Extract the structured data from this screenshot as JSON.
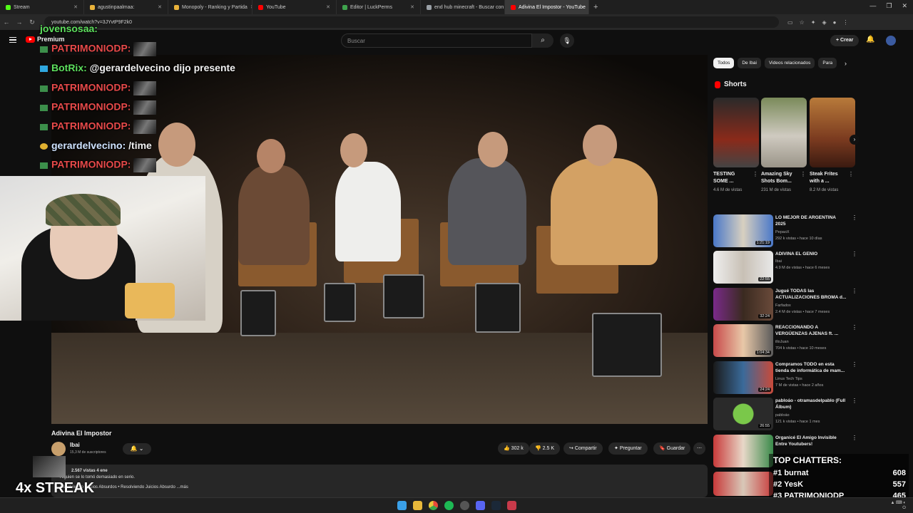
{
  "browser": {
    "tabs": [
      {
        "label": "Stream",
        "color": "#53fc18"
      },
      {
        "label": "agustinpaalmaa:",
        "color": "#e9b23a"
      },
      {
        "label": "Monopoly - Ranking y Partida",
        "color": "#e9b23a"
      },
      {
        "label": "YouTube",
        "color": "#ff0000"
      },
      {
        "label": "Editor | LuckPerms",
        "color": "#3fa34d"
      },
      {
        "label": "end hub minecraft - Buscar con",
        "color": "#9aa0a6"
      },
      {
        "label": "Adivina El Impostor - YouTube",
        "color": "#ff0000"
      }
    ],
    "new_tab": "+",
    "url": "youtube.com/watch?v=3JYvtP9F2k0"
  },
  "header": {
    "premium_label": "Premium",
    "search_placeholder": "Buscar",
    "create_label": "Crear"
  },
  "chat_overlay": [
    {
      "user": "jovensosaa:",
      "text": "",
      "style": "u2"
    },
    {
      "user": "PATRIMONIODP:",
      "text": "",
      "style": "u1"
    },
    {
      "user": "BotRix:",
      "text": "@gerardelvecino dijo presente",
      "style": "u2"
    },
    {
      "user": "PATRIMONIODP:",
      "text": "",
      "style": "u1"
    },
    {
      "user": "PATRIMONIODP:",
      "text": "",
      "style": "u1"
    },
    {
      "user": "PATRIMONIODP:",
      "text": "",
      "style": "u1"
    },
    {
      "user": "gerardelvecino:",
      "text": "/time",
      "style": "u3"
    },
    {
      "user": "PATRIMONIODP:",
      "text": "",
      "style": "u1"
    }
  ],
  "video": {
    "title": "Adivina El Impostor",
    "channel": "Ibai",
    "subscribers": "15,3 M de suscriptores",
    "likes": "302 k",
    "dislikes": "2.5 K",
    "share": "Compartir",
    "ask": "Preguntar",
    "save": "Guardar",
    "views_date": "2.567 vistas 4 ene",
    "desc_line1": "Alguien se lo tomó demasiado en serio.",
    "desc_line2": "Resolviendo Juicios Absurdos • Resolviendo Juicios Absurdo ...más"
  },
  "streak": "4x STREAK",
  "sidebar": {
    "chips": [
      "Todos",
      "De Ibai",
      "Videos relacionados",
      "Para"
    ],
    "shorts_title": "Shorts",
    "shorts": [
      {
        "title": "TESTING SOME ...",
        "views": "4.6 M de vistas"
      },
      {
        "title": "Amazing Sky Shots Bom...",
        "views": "231 M de vistas"
      },
      {
        "title": "Steak Frites with a ...",
        "views": "8.2 M de vistas"
      }
    ],
    "recommendations": [
      {
        "title": "LO MEJOR DE ARGENTINA 2025",
        "channel": "PepaoX",
        "views": "292 k vistas • hace 10 días",
        "duration": "1:21:19"
      },
      {
        "title": "ADIVINA EL GENIO",
        "channel": "Ibai",
        "views": "4.9 M de vistas • hace 6 meses",
        "duration": "22:55"
      },
      {
        "title": "Jugué TODAS las ACTUALIZACIONES BROMA d...",
        "channel": "Farfadox",
        "views": "2.4 M de vistas • hace 7 meses",
        "duration": "32:24"
      },
      {
        "title": "REACCIONANDO A VERGÜENZAS AJENAS ft. ...",
        "channel": "illoJuan",
        "views": "704 k vistas • hace 10 meses",
        "duration": "1:04:34"
      },
      {
        "title": "Compramos TODO en esta tienda de informática de mam...",
        "channel": "Linus Tech Tips",
        "views": "7 M de vistas • hace 2 años",
        "duration": "24:24"
      },
      {
        "title": "pabloáo - otramasdelpablo (Full Álbum)",
        "channel": "pabloáo",
        "views": "121 k vistas • hace 1 mes",
        "duration": "26:55"
      },
      {
        "title": "Organicé El Amigo Invisible Entre Youtubers!",
        "channel": "",
        "views": "",
        "duration": ""
      }
    ]
  },
  "top_chatters": {
    "title": "TOP CHATTERS:",
    "rows": [
      {
        "rank": "#1",
        "name": "burnat",
        "count": "608"
      },
      {
        "rank": "#2",
        "name": "YesK",
        "count": "557"
      },
      {
        "rank": "#3",
        "name": "PATRIMONIODP",
        "count": "465"
      }
    ]
  }
}
